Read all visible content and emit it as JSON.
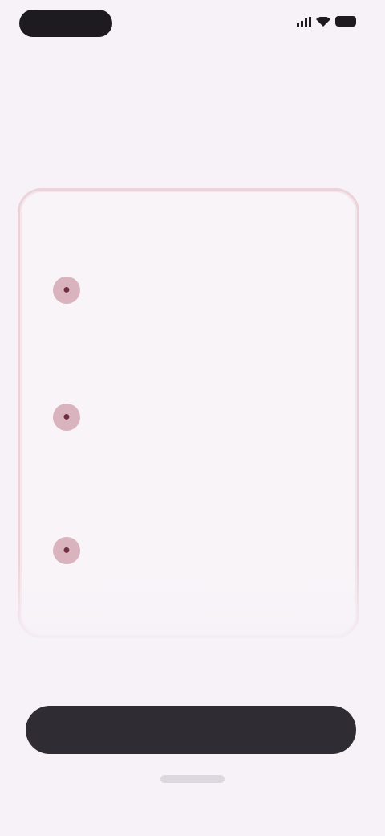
{
  "status_bar": {
    "time": "",
    "icons": [
      "signal-icon",
      "wifi-icon",
      "battery-icon"
    ]
  },
  "page": {
    "title": ""
  },
  "card": {
    "intro": "",
    "sections": [
      {
        "heading": "",
        "items": [
          {
            "icon": "bullet-icon",
            "text": ""
          }
        ]
      },
      {
        "heading": "",
        "items": [
          {
            "icon": "bullet-icon",
            "text": ""
          }
        ]
      },
      {
        "heading": "",
        "items": [
          {
            "icon": "bullet-icon",
            "text": ""
          }
        ]
      }
    ]
  },
  "button": {
    "label": ""
  },
  "colors": {
    "background": "#f6f2f7",
    "card_border": "#ecd3da",
    "icon_fill": "#d9b3bd",
    "button_fill": "#302c33"
  }
}
